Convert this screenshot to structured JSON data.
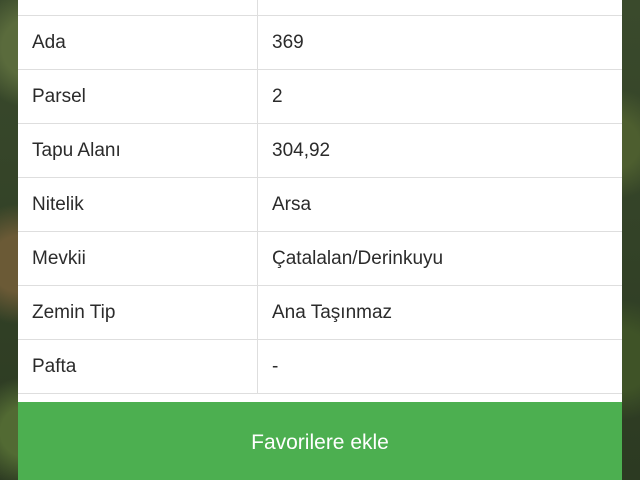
{
  "table": {
    "rows": [
      {
        "key": "",
        "value": ""
      },
      {
        "key": "Ada",
        "value": "369"
      },
      {
        "key": "Parsel",
        "value": "2"
      },
      {
        "key": "Tapu Alanı",
        "value": "304,92"
      },
      {
        "key": "Nitelik",
        "value": "Arsa"
      },
      {
        "key": "Mevkii",
        "value": "Çatalalan/Derinkuyu"
      },
      {
        "key": "Zemin Tip",
        "value": "Ana Taşınmaz"
      },
      {
        "key": "Pafta",
        "value": "-"
      }
    ]
  },
  "actions": {
    "favorite_label": "Favorilere ekle"
  },
  "colors": {
    "accent": "#4caf50"
  }
}
